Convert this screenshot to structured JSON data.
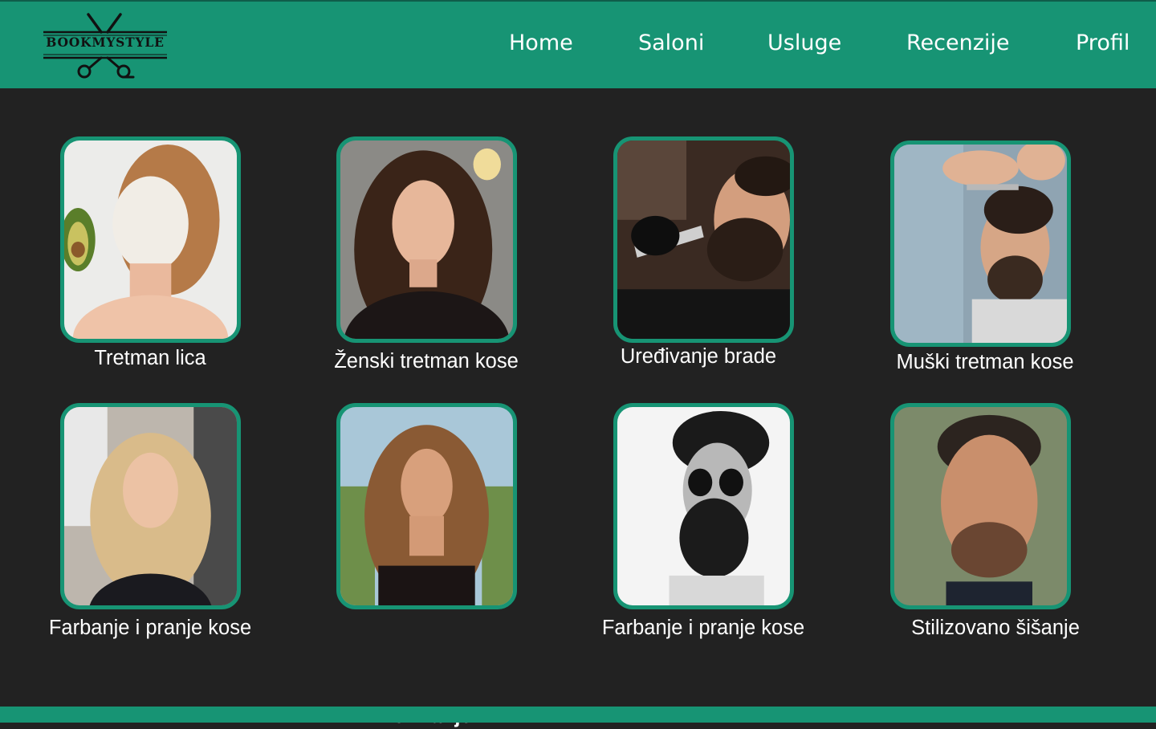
{
  "brand": {
    "name": "BOOKMYSTYLE",
    "logo_icon": "scissors-logo-icon",
    "color": "#179474"
  },
  "nav": {
    "items": [
      {
        "label": "Home"
      },
      {
        "label": "Saloni"
      },
      {
        "label": "Usluge"
      },
      {
        "label": "Recenzije"
      },
      {
        "label": "Profil"
      }
    ]
  },
  "services": [
    {
      "label": "Tretman lica",
      "image": "woman-face-mask-photo"
    },
    {
      "label": "Ženski tretman kose",
      "image": "woman-long-brown-hair-photo"
    },
    {
      "label": "Uređivanje brade",
      "image": "man-beard-trim-photo"
    },
    {
      "label": "Muški tretman kose",
      "image": "man-haircut-photo"
    },
    {
      "label": "Farbanje i pranje kose",
      "image": "woman-blonde-waves-photo"
    },
    {
      "label": "Feniranje",
      "image": "woman-curly-hair-photo"
    },
    {
      "label": "Farbanje i pranje kose",
      "image": "man-sunglasses-beard-photo"
    },
    {
      "label": "Stilizovano šišanje",
      "image": "man-short-fade-photo"
    }
  ],
  "colors": {
    "accent": "#179474",
    "background": "#222222",
    "text": "#ffffff"
  }
}
